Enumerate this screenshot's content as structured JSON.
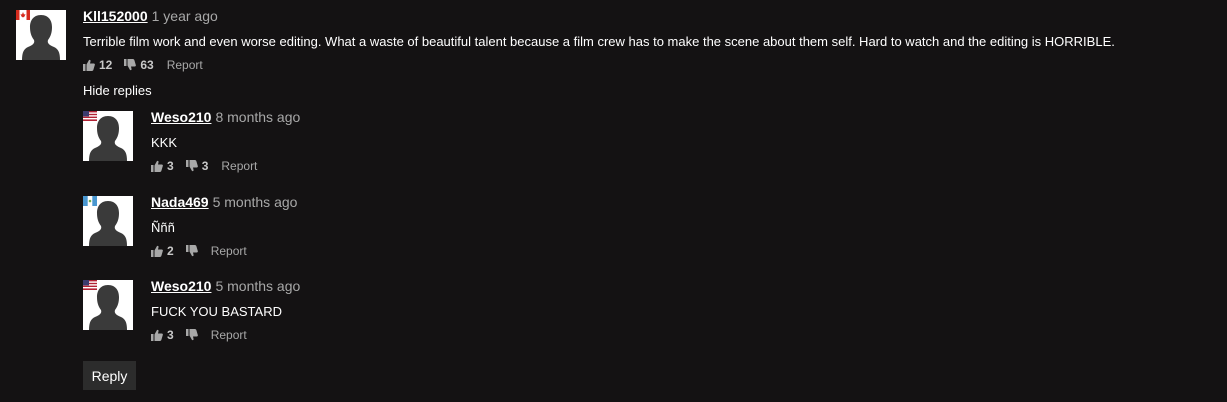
{
  "top_comment": {
    "username": "Kll152000",
    "time": "1 year ago",
    "text": "Terrible film work and even worse editing. What a waste of beautiful talent because a film crew has to make the scene about them self. Hard to watch and the editing is HORRIBLE.",
    "likes": "12",
    "dislikes": "63",
    "report_label": "Report",
    "flag": "canada-flag-icon"
  },
  "hide_replies_label": "Hide replies",
  "replies": [
    {
      "username": "Weso210",
      "time": "8 months ago",
      "text": "KKK",
      "likes": "3",
      "dislikes": "3",
      "report_label": "Report",
      "flag": "usa-flag-icon"
    },
    {
      "username": "Nada469",
      "time": "5 months ago",
      "text": "Ñññ",
      "likes": "2",
      "dislikes": "",
      "report_label": "Report",
      "flag": "guatemala-flag-icon"
    },
    {
      "username": "Weso210",
      "time": "5 months ago",
      "text": "FUCK YOU BASTARD",
      "likes": "3",
      "dislikes": "",
      "report_label": "Report",
      "flag": "usa-flag-icon"
    }
  ],
  "reply_button_label": "Reply",
  "colors": {
    "background": "#141213",
    "muted_text": "#a8a8a8",
    "reply_button_bg": "#2c2c2c"
  }
}
